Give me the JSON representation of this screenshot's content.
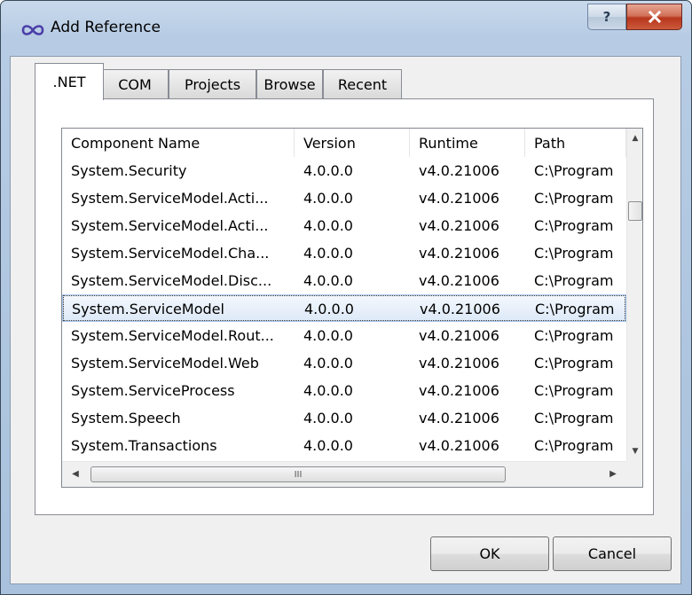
{
  "window": {
    "title": "Add Reference",
    "app_icon": "infinity-icon",
    "help_label": "?",
    "close_icon": "close-icon"
  },
  "tabs": [
    {
      "label": ".NET",
      "active": true
    },
    {
      "label": "COM",
      "active": false
    },
    {
      "label": "Projects",
      "active": false
    },
    {
      "label": "Browse",
      "active": false
    },
    {
      "label": "Recent",
      "active": false
    }
  ],
  "list": {
    "columns": [
      "Component Name",
      "Version",
      "Runtime",
      "Path"
    ],
    "rows": [
      {
        "name": "System.Security",
        "version": "4.0.0.0",
        "runtime": "v4.0.21006",
        "path": "C:\\Program",
        "selected": false
      },
      {
        "name": "System.ServiceModel.Acti...",
        "version": "4.0.0.0",
        "runtime": "v4.0.21006",
        "path": "C:\\Program",
        "selected": false
      },
      {
        "name": "System.ServiceModel.Acti...",
        "version": "4.0.0.0",
        "runtime": "v4.0.21006",
        "path": "C:\\Program",
        "selected": false
      },
      {
        "name": "System.ServiceModel.Cha...",
        "version": "4.0.0.0",
        "runtime": "v4.0.21006",
        "path": "C:\\Program",
        "selected": false
      },
      {
        "name": "System.ServiceModel.Disc...",
        "version": "4.0.0.0",
        "runtime": "v4.0.21006",
        "path": "C:\\Program",
        "selected": false
      },
      {
        "name": "System.ServiceModel",
        "version": "4.0.0.0",
        "runtime": "v4.0.21006",
        "path": "C:\\Program",
        "selected": true
      },
      {
        "name": "System.ServiceModel.Rout...",
        "version": "4.0.0.0",
        "runtime": "v4.0.21006",
        "path": "C:\\Program",
        "selected": false
      },
      {
        "name": "System.ServiceModel.Web",
        "version": "4.0.0.0",
        "runtime": "v4.0.21006",
        "path": "C:\\Program",
        "selected": false
      },
      {
        "name": "System.ServiceProcess",
        "version": "4.0.0.0",
        "runtime": "v4.0.21006",
        "path": "C:\\Program",
        "selected": false
      },
      {
        "name": "System.Speech",
        "version": "4.0.0.0",
        "runtime": "v4.0.21006",
        "path": "C:\\Program",
        "selected": false
      },
      {
        "name": "System.Transactions",
        "version": "4.0.0.0",
        "runtime": "v4.0.21006",
        "path": "C:\\Program",
        "selected": false
      }
    ],
    "hscroll_grip": "III"
  },
  "buttons": {
    "ok_label": "OK",
    "cancel_label": "Cancel"
  }
}
